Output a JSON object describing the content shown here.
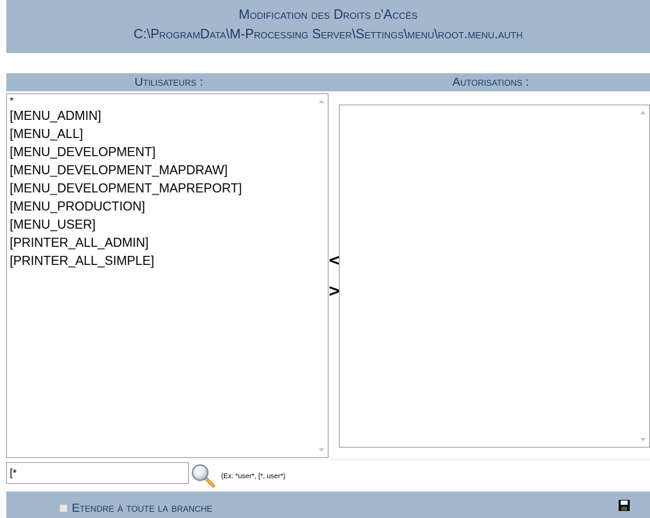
{
  "header": {
    "title": "Modification des Droits d'Accès",
    "path": "C:\\ProgramData\\M-Processing Server\\Settings\\menu\\root.menu.auth"
  },
  "users_panel": {
    "heading": "Utilisateurs :",
    "items": [
      "*",
      "[MENU_ADMIN]",
      "[MENU_ALL]",
      "[MENU_DEVELOPMENT]",
      "[MENU_DEVELOPMENT_MAPDRAW]",
      "[MENU_DEVELOPMENT_MAPREPORT]",
      "[MENU_PRODUCTION]",
      "[MENU_USER]",
      "[PRINTER_ALL_ADMIN]",
      "[PRINTER_ALL_SIMPLE]"
    ]
  },
  "auth_panel": {
    "heading": "Autorisations :",
    "items": []
  },
  "transfer": {
    "left_label": "<",
    "right_label": ">"
  },
  "filter": {
    "value": "[*",
    "hint": "(Ex: *user*, [*, user*)"
  },
  "footer": {
    "extend_label": "Etendre à toute la branche",
    "extend_checked": false
  },
  "colors": {
    "bar_background": "#a3b8cd",
    "heading_text": "#1e3a5f"
  },
  "icons": {
    "search": "magnifier-icon",
    "save": "floppy-disk-icon"
  }
}
